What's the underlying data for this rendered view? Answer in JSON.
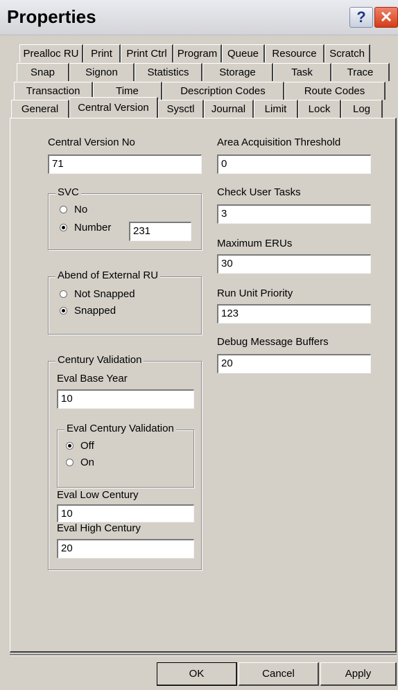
{
  "window": {
    "title": "Properties"
  },
  "titlebar": {
    "help_glyph": "?",
    "close_glyph": "✕"
  },
  "tabs": {
    "row1": [
      "Prealloc RU",
      "Print",
      "Print Ctrl",
      "Program",
      "Queue",
      "Resource",
      "Scratch"
    ],
    "row2": [
      "Snap",
      "Signon",
      "Statistics",
      "Storage",
      "Task",
      "Trace"
    ],
    "row3": [
      "Transaction",
      "Time",
      "Description Codes",
      "Route Codes"
    ],
    "row4": [
      "General",
      "Central Version",
      "Sysctl",
      "Journal",
      "Limit",
      "Lock",
      "Log"
    ],
    "active": "Central Version"
  },
  "form": {
    "central_version_no": {
      "label": "Central Version No",
      "value": "71"
    },
    "svc": {
      "legend": "SVC",
      "opt_no": "No",
      "opt_number": "Number",
      "selected": "Number",
      "number_value": "231"
    },
    "abend": {
      "legend": "Abend of External RU",
      "opt_not_snapped": "Not Snapped",
      "opt_snapped": "Snapped",
      "selected": "Snapped"
    },
    "century": {
      "legend": "Century Validation",
      "eval_base_year_label": "Eval Base Year",
      "eval_base_year": "10",
      "eval_cv_legend": "Eval Century Validation",
      "opt_off": "Off",
      "opt_on": "On",
      "selected": "Off",
      "eval_low_label": "Eval Low Century",
      "eval_low": "10",
      "eval_high_label": "Eval High Century",
      "eval_high": "20"
    },
    "area_acq": {
      "label": "Area Acquisition Threshold",
      "value": "0"
    },
    "check_user_tasks": {
      "label": "Check User Tasks",
      "value": "3"
    },
    "max_erus": {
      "label": "Maximum ERUs",
      "value": "30"
    },
    "run_unit_priority": {
      "label": "Run Unit Priority",
      "value": "123"
    },
    "debug_buffers": {
      "label": "Debug Message Buffers",
      "value": "20"
    }
  },
  "buttons": {
    "ok": "OK",
    "cancel": "Cancel",
    "apply": "Apply"
  }
}
